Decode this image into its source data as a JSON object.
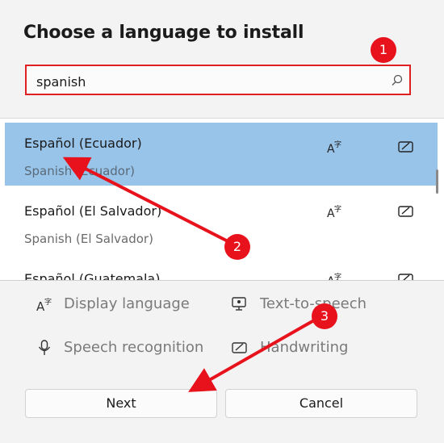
{
  "dialog": {
    "title": "Choose a language to install",
    "search": {
      "value": "spanish",
      "icon": "search-icon"
    }
  },
  "languages": [
    {
      "name": "Español (Ecuador)",
      "sub": "Spanish (Ecuador)",
      "selected": true
    },
    {
      "name": "Español (El Salvador)",
      "sub": "Spanish (El Salvador)",
      "selected": false
    },
    {
      "name": "Español (Guatemala)",
      "sub": "",
      "selected": false
    }
  ],
  "features": {
    "display_language": "Display language",
    "text_to_speech": "Text-to-speech",
    "speech_recognition": "Speech recognition",
    "handwriting": "Handwriting"
  },
  "buttons": {
    "next": "Next",
    "cancel": "Cancel"
  },
  "annotations": {
    "step1": "1",
    "step2": "2",
    "step3": "3",
    "color": "#e8121c"
  },
  "colors": {
    "selected_row": "#99c4ea",
    "accent_red": "#e02020"
  }
}
